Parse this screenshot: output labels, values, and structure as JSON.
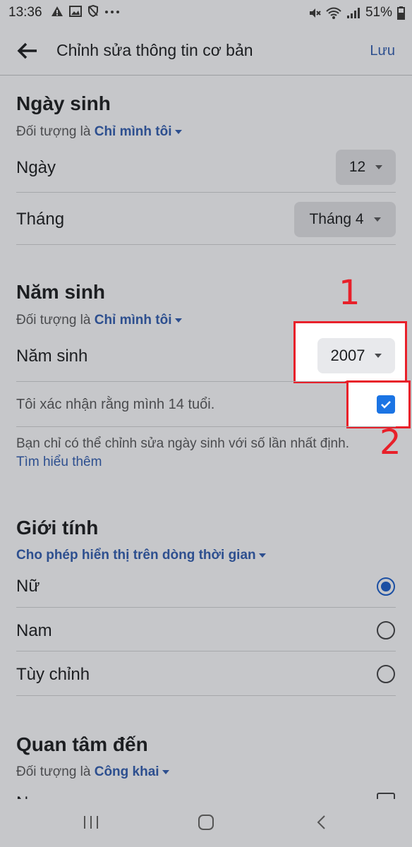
{
  "status_bar": {
    "time": "13:36",
    "battery": "51%"
  },
  "header": {
    "title": "Chỉnh sửa thông tin cơ bản",
    "save": "Lưu"
  },
  "birthday": {
    "title": "Ngày sinh",
    "audience_prefix": "Đối tượng là",
    "audience_value": "Chỉ mình tôi",
    "day_label": "Ngày",
    "day_value": "12",
    "month_label": "Tháng",
    "month_value": "Tháng 4"
  },
  "birth_year": {
    "title": "Năm sinh",
    "audience_prefix": "Đối tượng là",
    "audience_value": "Chỉ mình tôi",
    "year_label": "Năm sinh",
    "year_value": "2007",
    "confirm_text": "Tôi xác nhận rằng mình 14 tuổi.",
    "note": "Bạn chỉ có thể chỉnh sửa ngày sinh với số lần nhất định.",
    "learn_more": "Tìm hiểu thêm"
  },
  "annotations": {
    "marker1": "1",
    "marker2": "2"
  },
  "gender": {
    "title": "Giới tính",
    "audience_value": "Cho phép hiển thị trên dòng thời gian",
    "options": [
      {
        "label": "Nữ",
        "selected": true
      },
      {
        "label": "Nam",
        "selected": false
      },
      {
        "label": "Tùy chỉnh",
        "selected": false
      }
    ]
  },
  "interested_in": {
    "title": "Quan tâm đến",
    "audience_prefix": "Đối tượng là",
    "audience_value": "Công khai",
    "first_option_partial": "N"
  },
  "colors": {
    "highlight": "#e8202a",
    "link": "#2d4f8f",
    "checkbox": "#1b74e4"
  }
}
